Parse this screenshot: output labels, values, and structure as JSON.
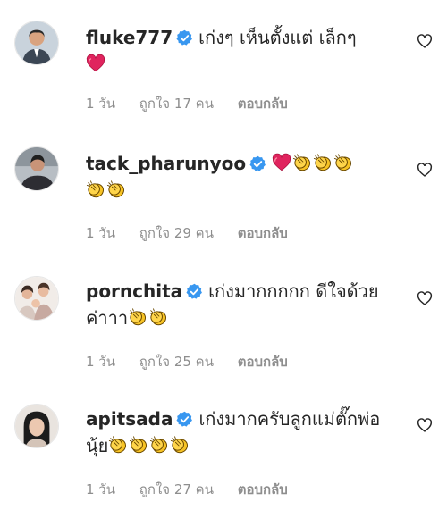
{
  "comments": [
    {
      "username": "fluke777",
      "text_line1": "เก่งๆ เห็นตั้งแต่ เล็กๆ",
      "text_line2": "",
      "emojis_line1": [],
      "emojis_line2": [
        "red-heart"
      ],
      "time": "1 วัน",
      "likes": "ถูกใจ 17 คน",
      "reply_label": "ตอบกลับ"
    },
    {
      "username": "tack_pharunyoo",
      "text_line1": "",
      "text_line2": "",
      "emojis_line1": [
        "red-heart",
        "clapping-hands",
        "clapping-hands",
        "clapping-hands"
      ],
      "emojis_line2": [
        "clapping-hands",
        "clapping-hands"
      ],
      "time": "1 วัน",
      "likes": "ถูกใจ 29 คน",
      "reply_label": "ตอบกลับ"
    },
    {
      "username": "pornchita",
      "text_line1": "เก่งมากกกกก ดีใจด้วย",
      "text_line2": "ค่าาา",
      "emojis_line1": [],
      "emojis_line2": [
        "clapping-hands",
        "clapping-hands"
      ],
      "time": "1 วัน",
      "likes": "ถูกใจ 25 คน",
      "reply_label": "ตอบกลับ"
    },
    {
      "username": "apitsada",
      "text_line1": "เก่งมากครับลูกแม่ตั๊กพ่อ",
      "text_line2": "นุ้ย",
      "emojis_line1": [],
      "emojis_line2": [
        "clapping-hands",
        "clapping-hands",
        "clapping-hands",
        "clapping-hands"
      ],
      "time": "1 วัน",
      "likes": "ถูกใจ 27 คน",
      "reply_label": "ตอบกลับ"
    }
  ],
  "colors": {
    "text": "#262626",
    "meta": "#8e8e8e",
    "verified": "#3897f0",
    "heart": "#e0245e",
    "clap": "#f7c325"
  },
  "icons": {
    "verified": "verified-badge-icon",
    "like": "heart-outline-icon"
  }
}
